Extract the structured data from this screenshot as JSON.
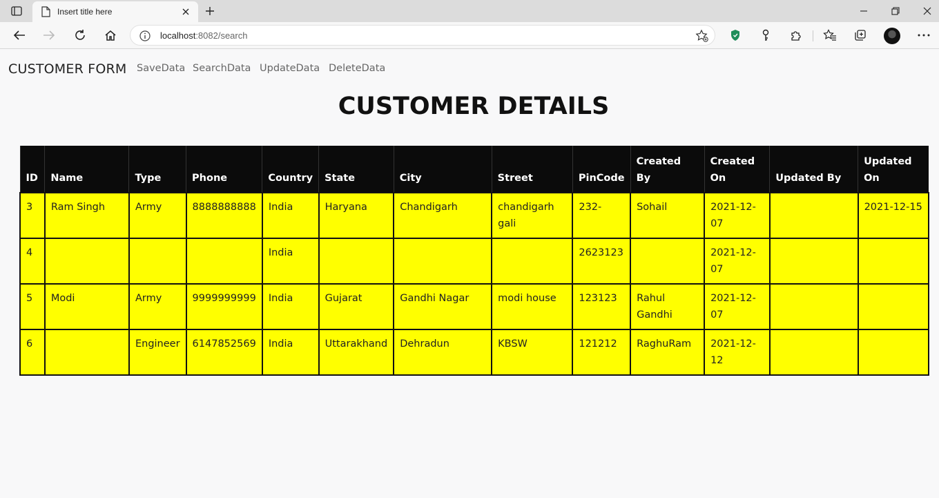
{
  "browser": {
    "tab_title": "Insert title here",
    "url_host": "localhost",
    "url_rest": ":8082/search"
  },
  "nav": {
    "brand": "CUSTOMER FORM",
    "links": [
      "SaveData",
      "SearchData",
      "UpdateData",
      "DeleteData"
    ]
  },
  "page": {
    "heading": "CUSTOMER DETAILS"
  },
  "table": {
    "headers": [
      "ID",
      "Name",
      "Type",
      "Phone",
      "Country",
      "State",
      "City",
      "Street",
      "PinCode",
      "Created By",
      "Created On",
      "Updated By",
      "Updated On"
    ],
    "rows": [
      [
        "3",
        "Ram Singh",
        "Army",
        "8888888888",
        "India",
        "Haryana",
        "Chandigarh",
        "chandigarh gali",
        "232-",
        "Sohail",
        "2021-12-07",
        "",
        "2021-12-15"
      ],
      [
        "4",
        "",
        "",
        "",
        "India",
        "",
        "",
        "",
        "2623123",
        "",
        "2021-12-07",
        "",
        ""
      ],
      [
        "5",
        "Modi",
        "Army",
        "9999999999",
        "India",
        "Gujarat",
        "Gandhi Nagar",
        "modi house",
        "123123",
        "Rahul Gandhi",
        "2021-12-07",
        "",
        ""
      ],
      [
        "6",
        "",
        "Engineer",
        "6147852569",
        "India",
        "Uttarakhand",
        "Dehradun",
        "KBSW",
        "121212",
        "RaghuRam",
        "2021-12-12",
        "",
        ""
      ]
    ]
  },
  "colors": {
    "row_bg": "#ffff00",
    "header_bg": "#0b0b0b"
  }
}
